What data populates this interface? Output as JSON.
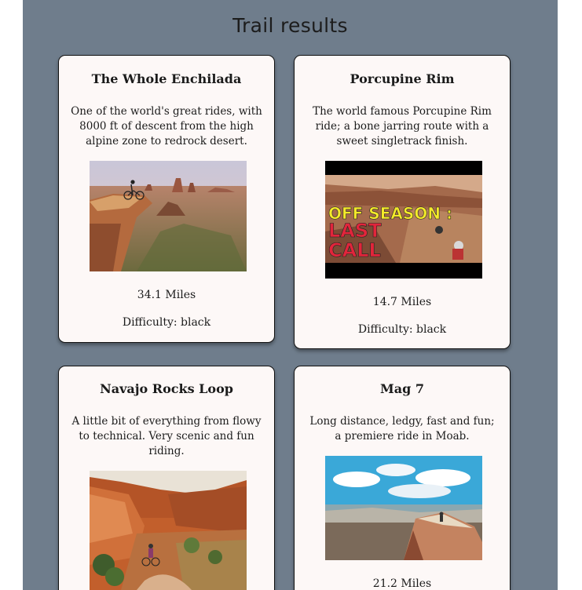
{
  "page": {
    "title": "Trail results"
  },
  "trails": [
    {
      "name": "The Whole Enchilada",
      "description": "One of the world's great rides, with 8000 ft of descent from the high alpine zone to redrock desert.",
      "miles": "34.1 Miles",
      "difficulty": "Difficulty: black",
      "image_alt": "Mountain biker on a cliff overlooking the desert"
    },
    {
      "name": "Porcupine Rim",
      "description": "The world famous Porcupine Rim ride; a bone jarring route with a sweet singletrack finish.",
      "miles": "14.7 Miles",
      "difficulty": "Difficulty: black",
      "image_alt": "Video thumbnail",
      "image_overlay_line1": "OFF SEASON :",
      "image_overlay_line2": "LAST",
      "image_overlay_line3": "CALL"
    },
    {
      "name": "Navajo Rocks Loop",
      "description": "A little bit of everything from flowy to technical. Very scenic and fun riding.",
      "miles": "",
      "difficulty": "",
      "image_alt": "Rider on red slickrock trail"
    },
    {
      "name": "Mag 7",
      "description": "Long distance, ledgy, fast and fun; a premiere ride in Moab.",
      "miles": "21.2 Miles",
      "difficulty": "",
      "image_alt": "Rider on a canyon rim under a blue sky"
    }
  ],
  "colors": {
    "page_background": "#6f7d8c",
    "card_background": "#fdf8f7"
  }
}
